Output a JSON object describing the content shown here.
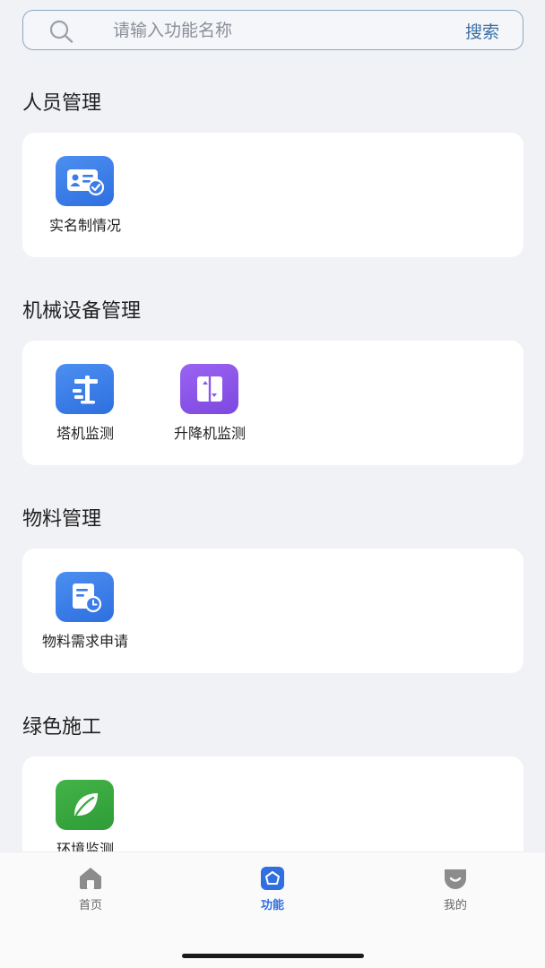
{
  "search": {
    "placeholder": "请输入功能名称",
    "button_label": "搜索",
    "icon": "search-icon"
  },
  "sections": [
    {
      "title": "人员管理",
      "items": [
        {
          "label": "实名制情况",
          "icon": "id-card-check-icon",
          "color": "#3b7ceb"
        }
      ]
    },
    {
      "title": "机械设备管理",
      "items": [
        {
          "label": "塔机监测",
          "icon": "tower-crane-icon",
          "color": "#3b7ceb"
        },
        {
          "label": "升降机监测",
          "icon": "elevator-icon",
          "color": "#8b55ea"
        }
      ]
    },
    {
      "title": "物料管理",
      "items": [
        {
          "label": "物料需求申请",
          "icon": "document-clock-icon",
          "color": "#3b7ceb"
        }
      ]
    },
    {
      "title": "绿色施工",
      "items": [
        {
          "label": "环境监测",
          "icon": "leaf-icon",
          "color": "#38a93f"
        }
      ]
    }
  ],
  "tabbar": {
    "tabs": [
      {
        "label": "首页",
        "icon": "home-icon",
        "active": false
      },
      {
        "label": "功能",
        "icon": "function-icon",
        "active": true
      },
      {
        "label": "我的",
        "icon": "profile-icon",
        "active": false
      }
    ],
    "active_color": "#2f6fe0",
    "inactive_color": "#666666"
  }
}
